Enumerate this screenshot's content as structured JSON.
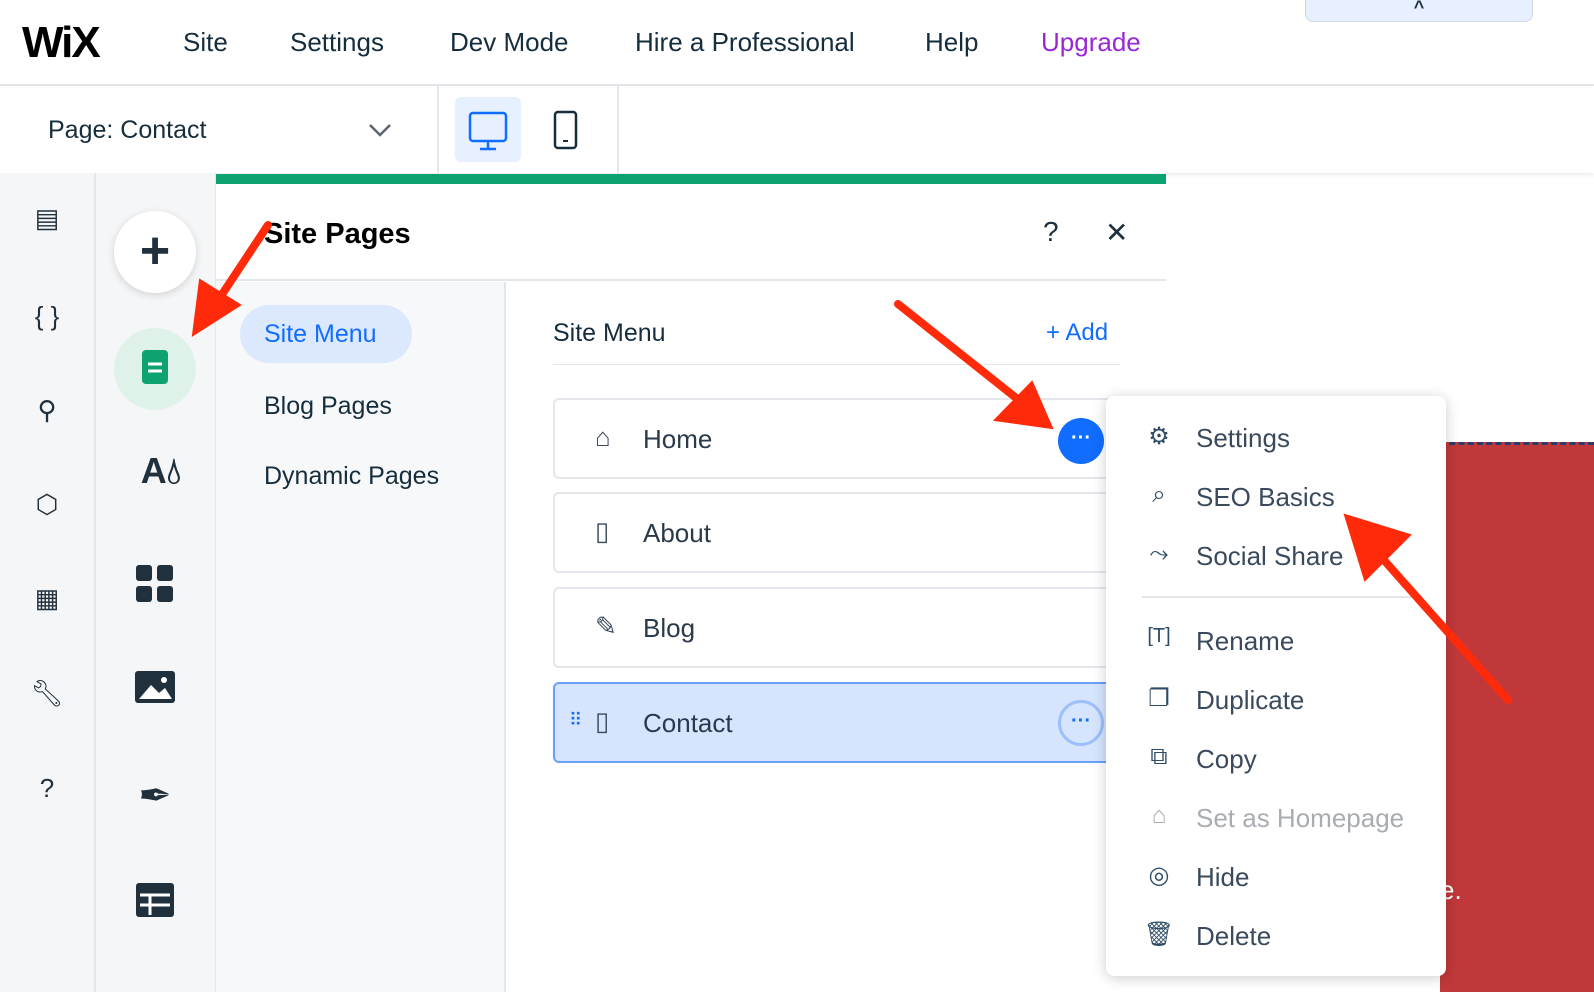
{
  "topbar": {
    "logo": "WiX",
    "nav": [
      "Site",
      "Settings",
      "Dev Mode",
      "Hire a Professional",
      "Help",
      "Upgrade"
    ],
    "upgrade_color": "#9a27d5",
    "collapse_label": "^"
  },
  "toolbar": {
    "page_prefix": "Page:",
    "page_name": "Contact"
  },
  "panel": {
    "title": "Site Pages",
    "help": "?",
    "close": "✕",
    "left_nav": [
      "Site Menu",
      "Blog Pages",
      "Dynamic Pages"
    ],
    "section_title": "Site Menu",
    "add_label": "+ Add",
    "pages": [
      {
        "label": "Home",
        "icon": "home-icon"
      },
      {
        "label": "About",
        "icon": "page-icon"
      },
      {
        "label": "Blog",
        "icon": "pen-icon"
      },
      {
        "label": "Contact",
        "icon": "page-icon",
        "selected": true
      }
    ]
  },
  "context_menu": {
    "items": [
      {
        "label": "Settings",
        "icon": "gear-icon"
      },
      {
        "label": "SEO Basics",
        "icon": "seo-icon"
      },
      {
        "label": "Social Share",
        "icon": "share-icon"
      },
      {
        "label": "Rename",
        "icon": "rename-icon"
      },
      {
        "label": "Duplicate",
        "icon": "duplicate-icon"
      },
      {
        "label": "Copy",
        "icon": "copy-icon"
      },
      {
        "label": "Set as Homepage",
        "icon": "home-icon",
        "disabled": true
      },
      {
        "label": "Hide",
        "icon": "hide-icon"
      },
      {
        "label": "Delete",
        "icon": "trash-icon"
      }
    ]
  },
  "canvas": {
    "partial_text": "e."
  },
  "colors": {
    "accent": "#116dff",
    "green": "#0ea271",
    "red_block": "#c1383a",
    "arrow": "#ff2a0a"
  }
}
